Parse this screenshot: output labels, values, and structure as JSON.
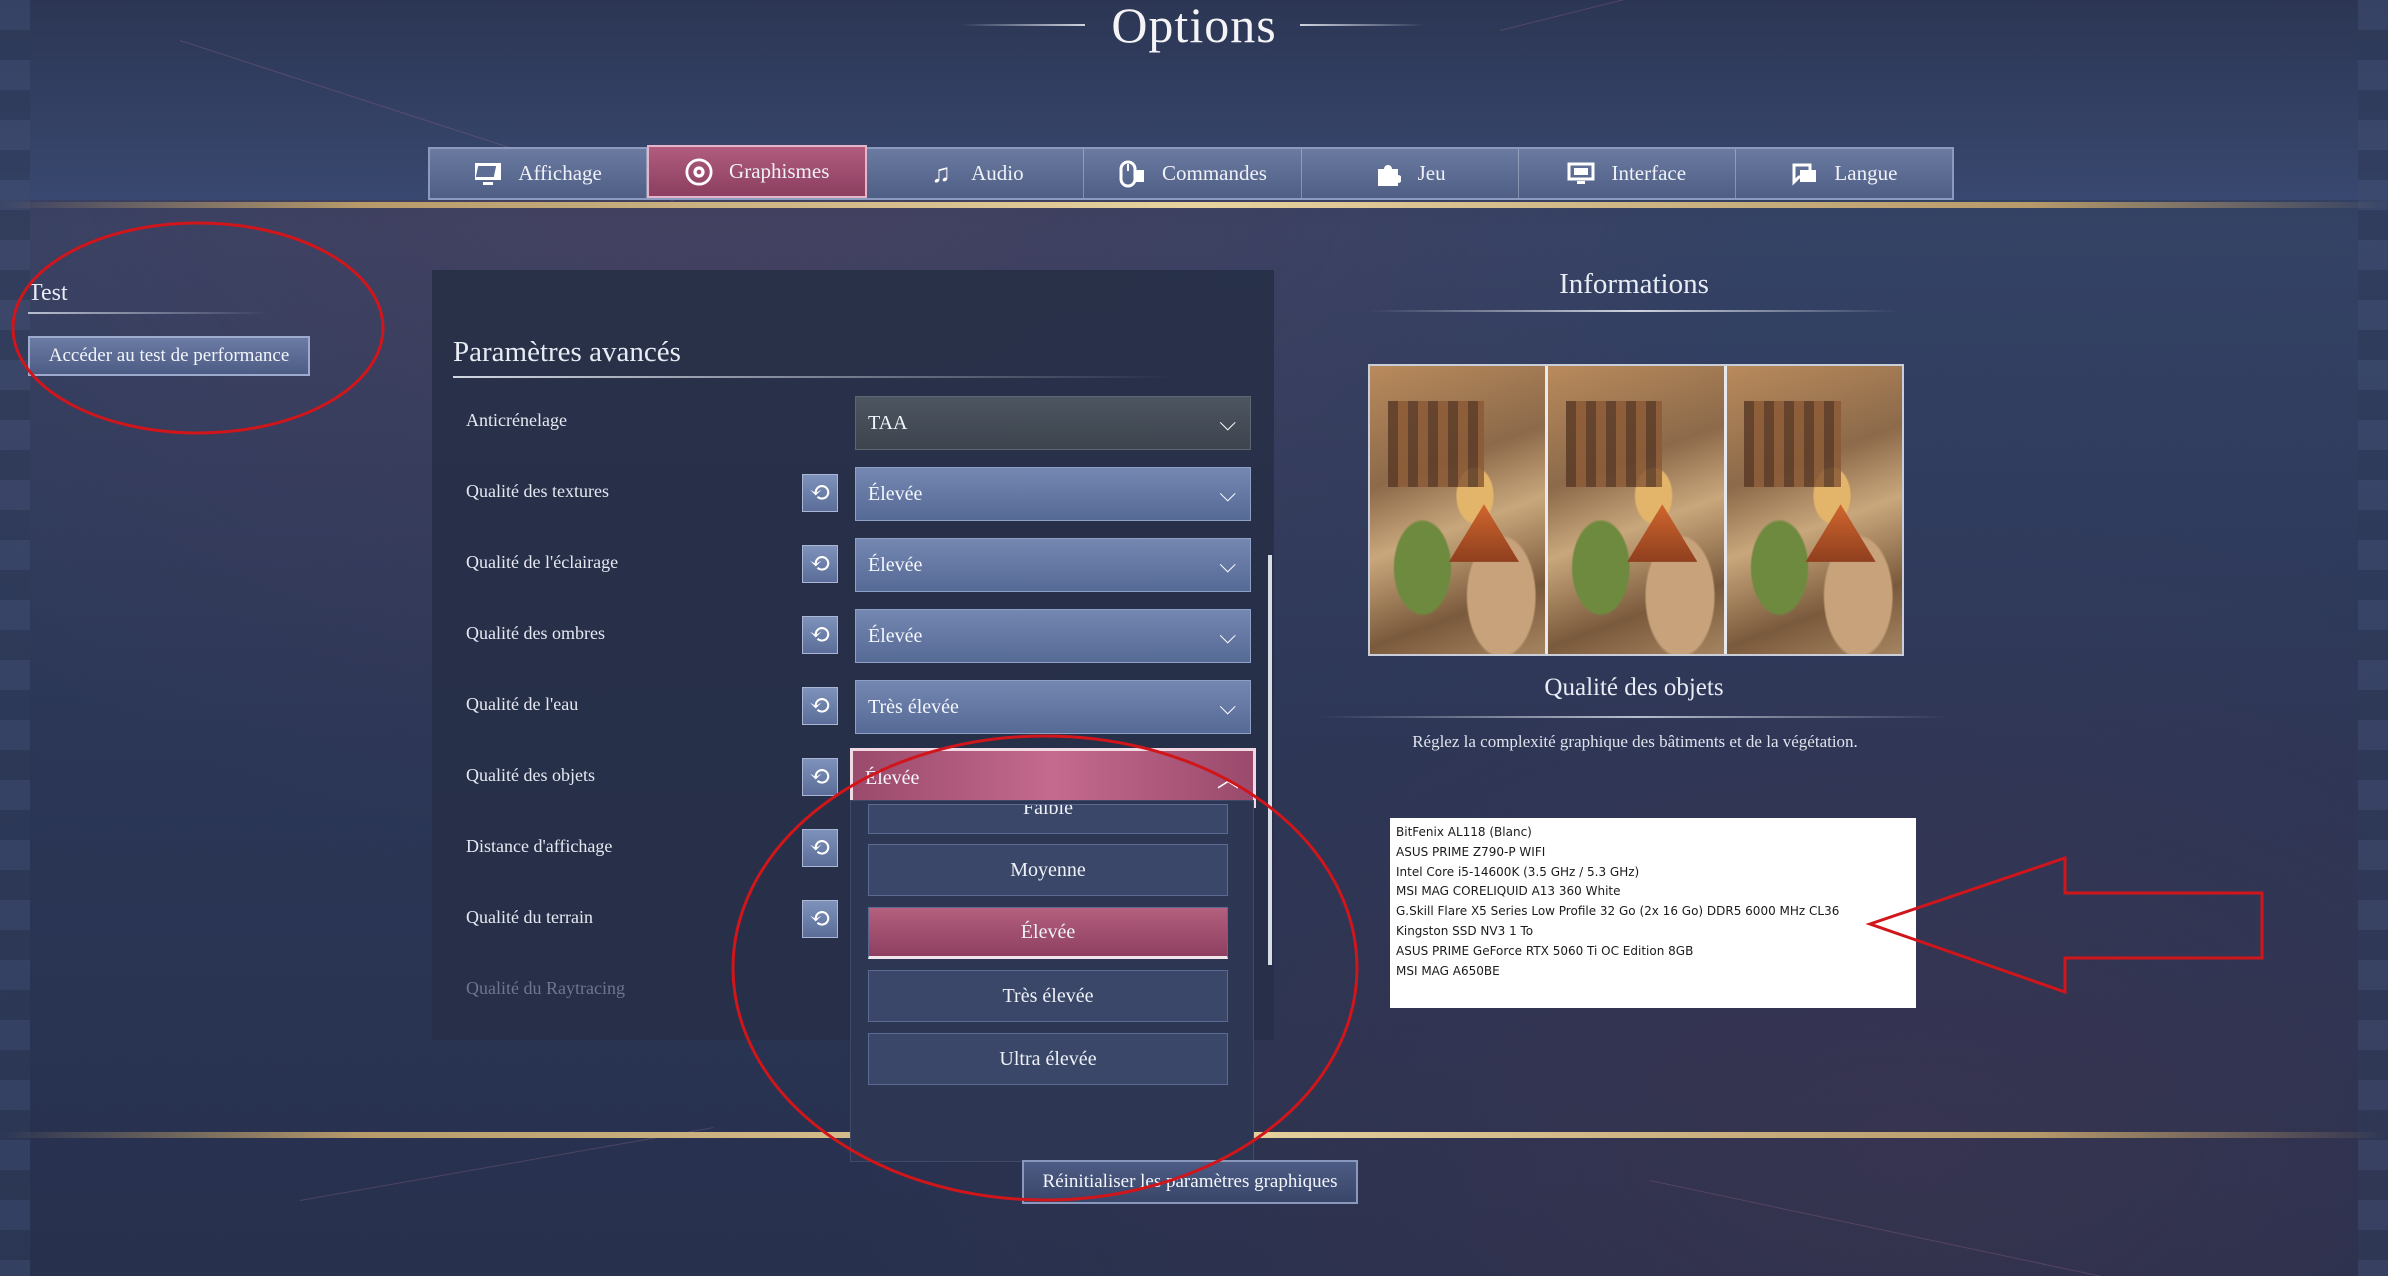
{
  "window": {
    "title": "Options"
  },
  "tabs": [
    {
      "label": "Affichage",
      "icon": "monitor-icon"
    },
    {
      "label": "Graphismes",
      "icon": "eye-icon",
      "active": true
    },
    {
      "label": "Audio",
      "icon": "music-note-icon"
    },
    {
      "label": "Commandes",
      "icon": "mouse-icon"
    },
    {
      "label": "Jeu",
      "icon": "puzzle-icon"
    },
    {
      "label": "Interface",
      "icon": "screen-icon"
    },
    {
      "label": "Langue",
      "icon": "speech-bubble-icon"
    }
  ],
  "test": {
    "title": "Test",
    "button_label": "Accéder au test de performance"
  },
  "advanced": {
    "title": "Paramètres avancés",
    "rows": [
      {
        "label": "Anticrénelage",
        "value": "TAA"
      },
      {
        "label": "Qualité des textures",
        "value": "Élevée"
      },
      {
        "label": "Qualité de l'éclairage",
        "value": "Élevée"
      },
      {
        "label": "Qualité des ombres",
        "value": "Élevée"
      },
      {
        "label": "Qualité de l'eau",
        "value": "Très élevée"
      },
      {
        "label": "Qualité des objets",
        "value": "Élevée"
      },
      {
        "label": "Distance d'affichage"
      },
      {
        "label": "Qualité du terrain"
      },
      {
        "label": "Qualité du Raytracing"
      }
    ]
  },
  "dropdown": {
    "options": [
      "Faible",
      "Moyenne",
      "Élevée",
      "Très élevée",
      "Ultra élevée"
    ],
    "selected": "Élevée"
  },
  "info": {
    "title": "Informations",
    "subtitle": "Qualité des objets",
    "description": "Réglez la complexité graphique des bâtiments et de la végétation."
  },
  "specs": [
    "BitFenix AL118 (Blanc)",
    "ASUS PRIME Z790-P WIFI",
    "Intel Core i5-14600K (3.5 GHz / 5.3 GHz)",
    "MSI MAG CORELIQUID A13 360 White",
    "G.Skill Flare X5 Series Low Profile 32 Go (2x 16 Go) DDR5 6000 MHz CL36",
    "Kingston SSD NV3 1 To",
    "ASUS PRIME GeForce RTX 5060 Ti OC Edition 8GB",
    "MSI MAG A650BE"
  ],
  "footer": {
    "reset_label": "Réinitialiser les paramètres graphiques"
  },
  "colors": {
    "accent_active": "#a44f73",
    "tab_bg": "#5d6d96",
    "annotation": "#d0151b",
    "gold": "#e8d3a0"
  }
}
